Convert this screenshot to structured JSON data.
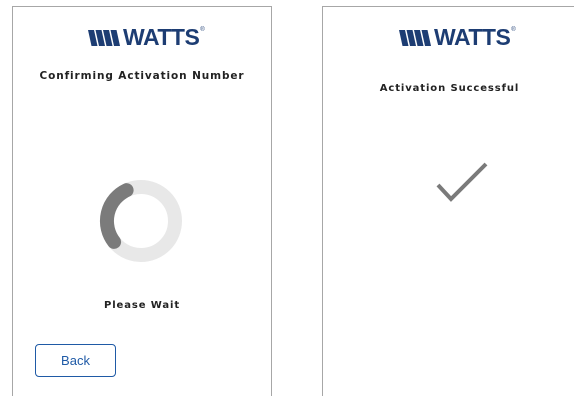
{
  "brand": {
    "logo_text": "WATTS",
    "logo_mark": "®"
  },
  "left_screen": {
    "heading": "Confirming Activation Number",
    "status": "Please Wait",
    "back_label": "Back"
  },
  "right_screen": {
    "heading": "Activation Successful"
  },
  "icons": {
    "spinner": "loading-spinner-icon",
    "success": "checkmark-icon"
  },
  "colors": {
    "brand_blue": "#1d3d73",
    "button_blue": "#1f5aa6",
    "spinner_track": "#e8e8e8",
    "spinner_arc": "#7b7b7b",
    "checkmark": "#7a7a7a"
  }
}
